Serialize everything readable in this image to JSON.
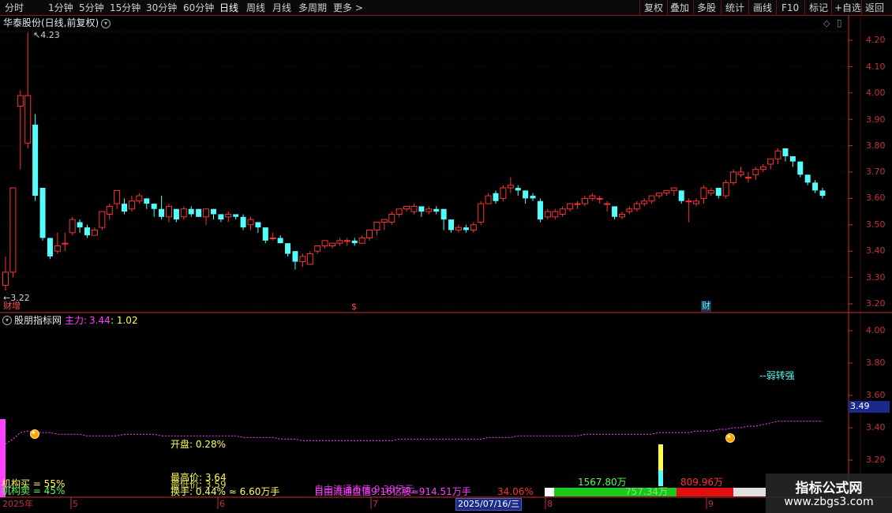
{
  "toolbar": {
    "periods": [
      "分时",
      "1分钟",
      "5分钟",
      "15分钟",
      "30分钟",
      "60分钟",
      "日线",
      "周线",
      "月线",
      "多周期",
      "更多"
    ],
    "active_period": "日线",
    "more_arrow": ">",
    "actions": [
      "复权",
      "叠加",
      "多股",
      "统计",
      "画线",
      "F10",
      "标记",
      "+自选",
      "返回"
    ]
  },
  "main_panel": {
    "title": "华泰股份(日线,前复权)",
    "high_label": "4.23",
    "low_label": "3.22",
    "y_axis": [
      "4.20",
      "4.10",
      "4.00",
      "3.90",
      "3.80",
      "3.70",
      "3.60",
      "3.50",
      "3.40",
      "3.30",
      "3.20"
    ],
    "markers": [
      "财增",
      "$",
      "财"
    ]
  },
  "indicator_panel": {
    "title": "股朋指标网",
    "main_force_label": "主力:",
    "main_force_value": "3.44",
    "ratio": ": 1.02",
    "y_axis": [
      "4.00",
      "3.80",
      "3.60",
      "3.40",
      "3.20"
    ],
    "current_value": "3.49",
    "signal_text": "--弱转强",
    "open_text": "开盘: 0.28%",
    "high_price_text": "最高价: 3.64",
    "low_price_text": "最低价: 3.59",
    "turnover_text": "换手: 0.44% ≈ 6.60万手",
    "inst_buy": "机构买 = 55%",
    "inst_sell": "机构卖 = 45%",
    "float_text": "自由流通盘值9.16亿股≈914.51万手",
    "float_overlay": "自由流通市值 9.38亿元",
    "pct_text": "34.06%",
    "buy_vol": "1567.80万",
    "mid_vol": "757.34万",
    "sell_vol": "809.96万"
  },
  "x_axis": {
    "labels": [
      "2025年",
      "5",
      "6",
      "7",
      "8",
      "9"
    ],
    "cursor_date": "2025/07/16/三"
  },
  "colors": {
    "up": "#ff3232",
    "down": "#54fcfc",
    "axis": "#c83232",
    "magenta": "#ff40ff",
    "yellow": "#ffff54"
  },
  "watermark": {
    "title": "指标公式网",
    "url": "www.zbgs3.com"
  },
  "chart_data": {
    "type": "candlestick",
    "title": "华泰股份(日线,前复权)",
    "ylim": [
      3.18,
      4.26
    ],
    "x_labels": [
      "2025年",
      "5",
      "6",
      "7",
      "8",
      "9"
    ],
    "candles": [
      [
        3.27,
        3.32,
        3.25,
        3.38
      ],
      [
        3.32,
        3.64,
        3.3,
        3.64
      ],
      [
        3.95,
        3.99,
        3.71,
        4.01
      ],
      [
        3.81,
        3.99,
        3.79,
        4.23
      ],
      [
        3.88,
        3.61,
        3.59,
        3.92
      ],
      [
        3.64,
        3.45,
        3.44,
        3.64
      ],
      [
        3.45,
        3.38,
        3.37,
        3.45
      ],
      [
        3.4,
        3.42,
        3.39,
        3.47
      ],
      [
        3.43,
        3.43,
        3.4,
        3.47
      ],
      [
        3.47,
        3.52,
        3.46,
        3.53
      ],
      [
        3.51,
        3.49,
        3.47,
        3.52
      ],
      [
        3.49,
        3.46,
        3.45,
        3.5
      ],
      [
        3.46,
        3.48,
        3.46,
        3.49
      ],
      [
        3.49,
        3.55,
        3.48,
        3.55
      ],
      [
        3.54,
        3.57,
        3.52,
        3.58
      ],
      [
        3.58,
        3.63,
        3.56,
        3.63
      ],
      [
        3.58,
        3.55,
        3.54,
        3.6
      ],
      [
        3.56,
        3.59,
        3.55,
        3.61
      ],
      [
        3.59,
        3.61,
        3.58,
        3.62
      ],
      [
        3.6,
        3.58,
        3.56,
        3.6
      ],
      [
        3.58,
        3.56,
        3.53,
        3.58
      ],
      [
        3.56,
        3.53,
        3.52,
        3.61
      ],
      [
        3.53,
        3.57,
        3.51,
        3.58
      ],
      [
        3.56,
        3.52,
        3.51,
        3.56
      ],
      [
        3.53,
        3.56,
        3.52,
        3.57
      ],
      [
        3.56,
        3.54,
        3.53,
        3.57
      ],
      [
        3.56,
        3.53,
        3.53,
        3.56
      ],
      [
        3.53,
        3.56,
        3.5,
        3.56
      ],
      [
        3.56,
        3.54,
        3.52,
        3.56
      ],
      [
        3.54,
        3.52,
        3.51,
        3.54
      ],
      [
        3.53,
        3.54,
        3.51,
        3.55
      ],
      [
        3.54,
        3.53,
        3.52,
        3.54
      ],
      [
        3.53,
        3.49,
        3.48,
        3.54
      ],
      [
        3.5,
        3.52,
        3.48,
        3.53
      ],
      [
        3.51,
        3.49,
        3.47,
        3.51
      ],
      [
        3.49,
        3.44,
        3.43,
        3.49
      ],
      [
        3.45,
        3.45,
        3.44,
        3.47
      ],
      [
        3.45,
        3.43,
        3.43,
        3.46
      ],
      [
        3.43,
        3.39,
        3.38,
        3.43
      ],
      [
        3.4,
        3.36,
        3.33,
        3.4
      ],
      [
        3.36,
        3.38,
        3.34,
        3.39
      ],
      [
        3.35,
        3.39,
        3.35,
        3.4
      ],
      [
        3.4,
        3.42,
        3.39,
        3.42
      ],
      [
        3.42,
        3.44,
        3.41,
        3.44
      ],
      [
        3.42,
        3.43,
        3.41,
        3.43
      ],
      [
        3.43,
        3.44,
        3.42,
        3.45
      ],
      [
        3.44,
        3.44,
        3.42,
        3.45
      ],
      [
        3.44,
        3.43,
        3.42,
        3.45
      ],
      [
        3.43,
        3.45,
        3.43,
        3.46
      ],
      [
        3.45,
        3.48,
        3.44,
        3.48
      ],
      [
        3.48,
        3.51,
        3.46,
        3.51
      ],
      [
        3.51,
        3.52,
        3.48,
        3.52
      ],
      [
        3.51,
        3.54,
        3.5,
        3.55
      ],
      [
        3.54,
        3.56,
        3.53,
        3.56
      ],
      [
        3.56,
        3.57,
        3.55,
        3.57
      ],
      [
        3.55,
        3.57,
        3.54,
        3.58
      ],
      [
        3.57,
        3.55,
        3.53,
        3.57
      ],
      [
        3.55,
        3.56,
        3.54,
        3.57
      ],
      [
        3.56,
        3.55,
        3.54,
        3.57
      ],
      [
        3.56,
        3.52,
        3.48,
        3.56
      ],
      [
        3.52,
        3.48,
        3.47,
        3.52
      ],
      [
        3.48,
        3.49,
        3.47,
        3.5
      ],
      [
        3.49,
        3.48,
        3.47,
        3.5
      ],
      [
        3.48,
        3.5,
        3.47,
        3.51
      ],
      [
        3.51,
        3.58,
        3.5,
        3.59
      ],
      [
        3.58,
        3.61,
        3.58,
        3.62
      ],
      [
        3.62,
        3.59,
        3.58,
        3.63
      ],
      [
        3.6,
        3.64,
        3.59,
        3.65
      ],
      [
        3.64,
        3.65,
        3.62,
        3.68
      ],
      [
        3.64,
        3.63,
        3.61,
        3.65
      ],
      [
        3.63,
        3.6,
        3.58,
        3.63
      ],
      [
        3.61,
        3.6,
        3.59,
        3.62
      ],
      [
        3.59,
        3.52,
        3.51,
        3.6
      ],
      [
        3.53,
        3.55,
        3.52,
        3.56
      ],
      [
        3.53,
        3.55,
        3.52,
        3.56
      ],
      [
        3.54,
        3.56,
        3.53,
        3.57
      ],
      [
        3.56,
        3.58,
        3.55,
        3.58
      ],
      [
        3.58,
        3.58,
        3.56,
        3.59
      ],
      [
        3.58,
        3.6,
        3.57,
        3.61
      ],
      [
        3.6,
        3.61,
        3.59,
        3.62
      ],
      [
        3.6,
        3.6,
        3.58,
        3.61
      ],
      [
        3.58,
        3.58,
        3.55,
        3.59
      ],
      [
        3.57,
        3.53,
        3.52,
        3.57
      ],
      [
        3.53,
        3.54,
        3.52,
        3.55
      ],
      [
        3.55,
        3.56,
        3.54,
        3.57
      ],
      [
        3.56,
        3.58,
        3.55,
        3.59
      ],
      [
        3.58,
        3.59,
        3.57,
        3.6
      ],
      [
        3.59,
        3.61,
        3.58,
        3.61
      ],
      [
        3.61,
        3.62,
        3.6,
        3.62
      ],
      [
        3.62,
        3.63,
        3.61,
        3.63
      ],
      [
        3.63,
        3.64,
        3.61,
        3.64
      ],
      [
        3.63,
        3.59,
        3.58,
        3.63
      ],
      [
        3.59,
        3.59,
        3.51,
        3.6
      ],
      [
        3.58,
        3.59,
        3.57,
        3.6
      ],
      [
        3.6,
        3.64,
        3.58,
        3.65
      ],
      [
        3.62,
        3.63,
        3.61,
        3.64
      ],
      [
        3.64,
        3.61,
        3.6,
        3.64
      ],
      [
        3.61,
        3.66,
        3.6,
        3.67
      ],
      [
        3.66,
        3.7,
        3.65,
        3.71
      ],
      [
        3.69,
        3.7,
        3.68,
        3.72
      ],
      [
        3.68,
        3.68,
        3.66,
        3.7
      ],
      [
        3.69,
        3.71,
        3.67,
        3.72
      ],
      [
        3.71,
        3.72,
        3.7,
        3.73
      ],
      [
        3.73,
        3.75,
        3.71,
        3.75
      ],
      [
        3.75,
        3.78,
        3.73,
        3.79
      ],
      [
        3.79,
        3.76,
        3.74,
        3.79
      ],
      [
        3.76,
        3.74,
        3.72,
        3.76
      ],
      [
        3.74,
        3.69,
        3.68,
        3.74
      ],
      [
        3.69,
        3.66,
        3.65,
        3.69
      ],
      [
        3.66,
        3.63,
        3.62,
        3.67
      ],
      [
        3.63,
        3.61,
        3.6,
        3.64
      ]
    ],
    "indicator": {
      "name": "主力",
      "ylim": [
        3.15,
        4.05
      ],
      "line": [
        3.3,
        3.33,
        3.37,
        3.38,
        3.37,
        3.37,
        3.37,
        3.36,
        3.36,
        3.36,
        3.36,
        3.35,
        3.35,
        3.35,
        3.35,
        3.35,
        3.36,
        3.36,
        3.36,
        3.36,
        3.36,
        3.35,
        3.35,
        3.35,
        3.35,
        3.35,
        3.35,
        3.35,
        3.35,
        3.35,
        3.35,
        3.35,
        3.34,
        3.34,
        3.34,
        3.34,
        3.34,
        3.33,
        3.33,
        3.33,
        3.32,
        3.32,
        3.32,
        3.32,
        3.32,
        3.32,
        3.32,
        3.32,
        3.32,
        3.32,
        3.32,
        3.32,
        3.32,
        3.33,
        3.33,
        3.33,
        3.33,
        3.33,
        3.33,
        3.33,
        3.33,
        3.33,
        3.33,
        3.33,
        3.33,
        3.34,
        3.34,
        3.34,
        3.34,
        3.35,
        3.35,
        3.35,
        3.35,
        3.35,
        3.35,
        3.35,
        3.35,
        3.35,
        3.36,
        3.36,
        3.36,
        3.36,
        3.36,
        3.36,
        3.36,
        3.36,
        3.36,
        3.36,
        3.37,
        3.37,
        3.37,
        3.37,
        3.37,
        3.38,
        3.38,
        3.38,
        3.39,
        3.39,
        3.4,
        3.4,
        3.41,
        3.41,
        3.42,
        3.43,
        3.44,
        3.44,
        3.44,
        3.44,
        3.44,
        3.44,
        3.44
      ]
    }
  }
}
